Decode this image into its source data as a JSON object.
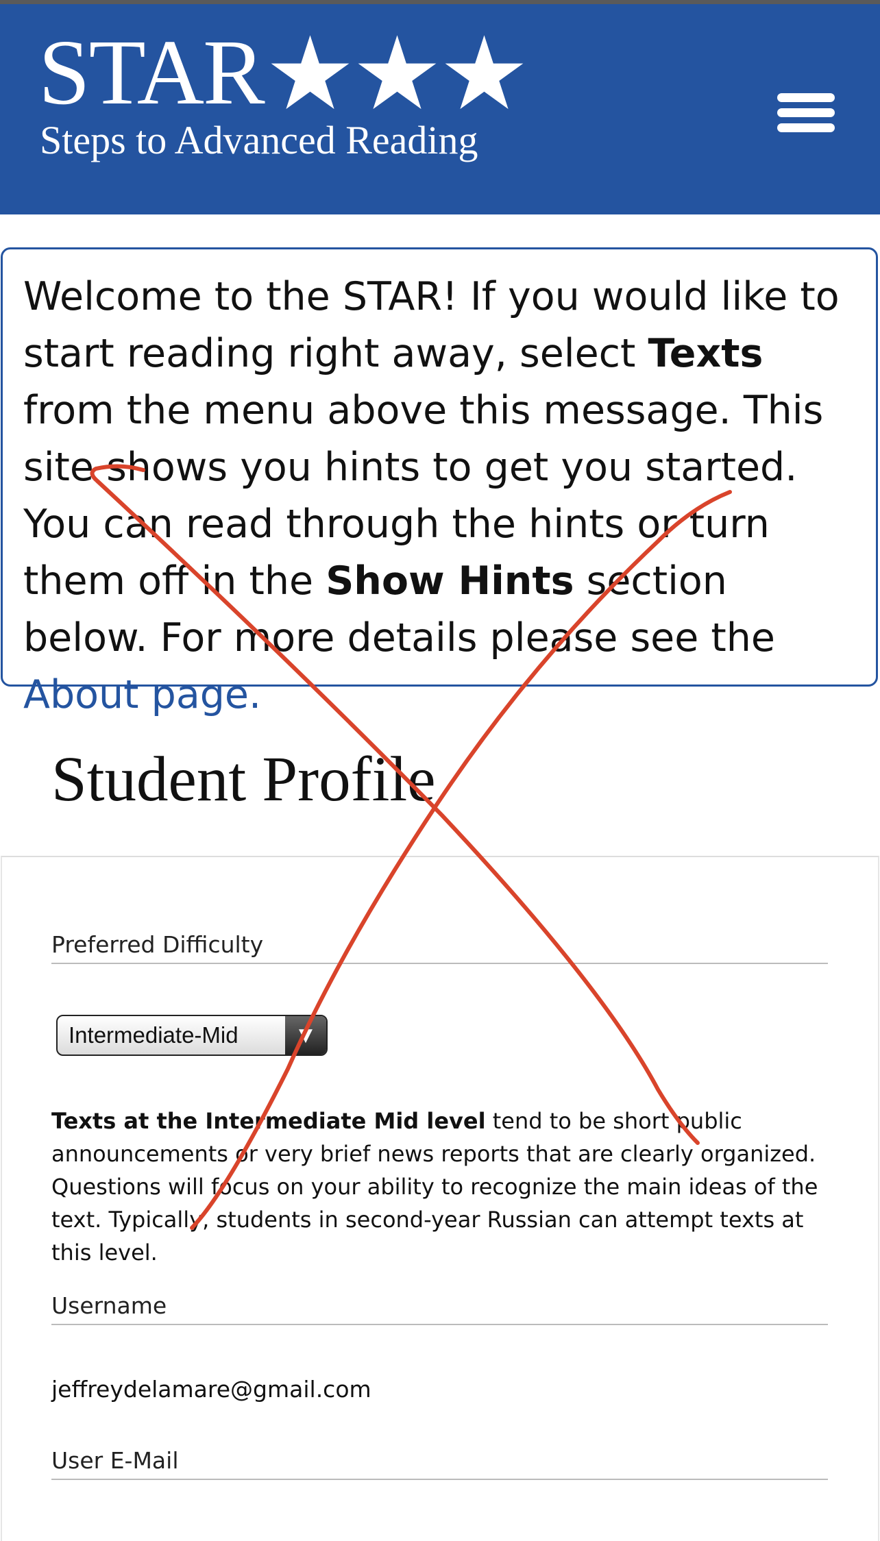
{
  "header": {
    "logo_title": "STAR",
    "logo_tagline": "Steps to Advanced Reading",
    "background_color": "#2454a0",
    "menu_icon": "hamburger-menu-icon"
  },
  "welcome": {
    "part1": "Welcome to the STAR! If you would like to start reading right away, select ",
    "texts_bold": "Texts",
    "part2": " from the menu above this message. This site shows you hints to get you started. You can read through the hints or turn them off in the ",
    "show_hints_bold": "Show Hints",
    "part3": " section below. For more details please see the ",
    "about_link": "About page."
  },
  "profile": {
    "title": "Student Profile",
    "difficulty_label": "Preferred Difficulty",
    "difficulty_selected": "Intermediate-Mid",
    "difficulty_arrow": "▼",
    "desc_bold": "Texts at the Intermediate Mid level",
    "desc_text": " tend to be short public announcements or very brief news reports that are clearly organized. Questions will focus on your ability to recognize the main ideas of the text. Typically, students in second-year Russian can attempt texts at this level.",
    "username_label": "Username",
    "username_value": "jeffreydelamare@gmail.com",
    "email_label": "User E-Mail"
  },
  "annotation": {
    "cross_color": "#d9442b"
  }
}
